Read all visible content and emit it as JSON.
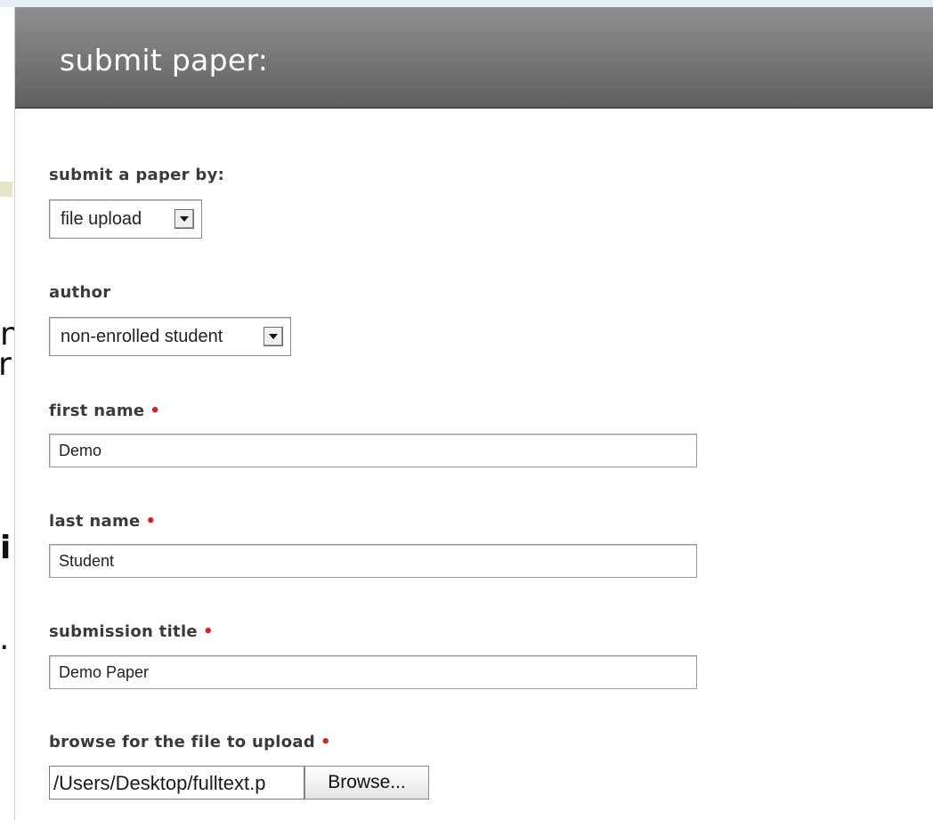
{
  "background_fragments": [
    "n",
    "r",
    "i",
    "."
  ],
  "form": {
    "title": "submit paper:",
    "submit_by": {
      "label": "submit a paper by:",
      "value": "file upload"
    },
    "author": {
      "label": "author",
      "value": "non-enrolled student"
    },
    "first_name": {
      "label": "first name",
      "value": "Demo",
      "required_marker": "•"
    },
    "last_name": {
      "label": "last name",
      "value": "Student",
      "required_marker": "•"
    },
    "submission_title": {
      "label": "submission title",
      "value": "Demo Paper",
      "required_marker": "•"
    },
    "file": {
      "label": "browse for the file to upload",
      "value": "/Users/Desktop/fulltext.p",
      "button_label": "Browse...",
      "required_marker": "•"
    }
  },
  "colors": {
    "header": "#7a7a7a",
    "required": "#e01b1b",
    "label": "#3a3a3a"
  }
}
